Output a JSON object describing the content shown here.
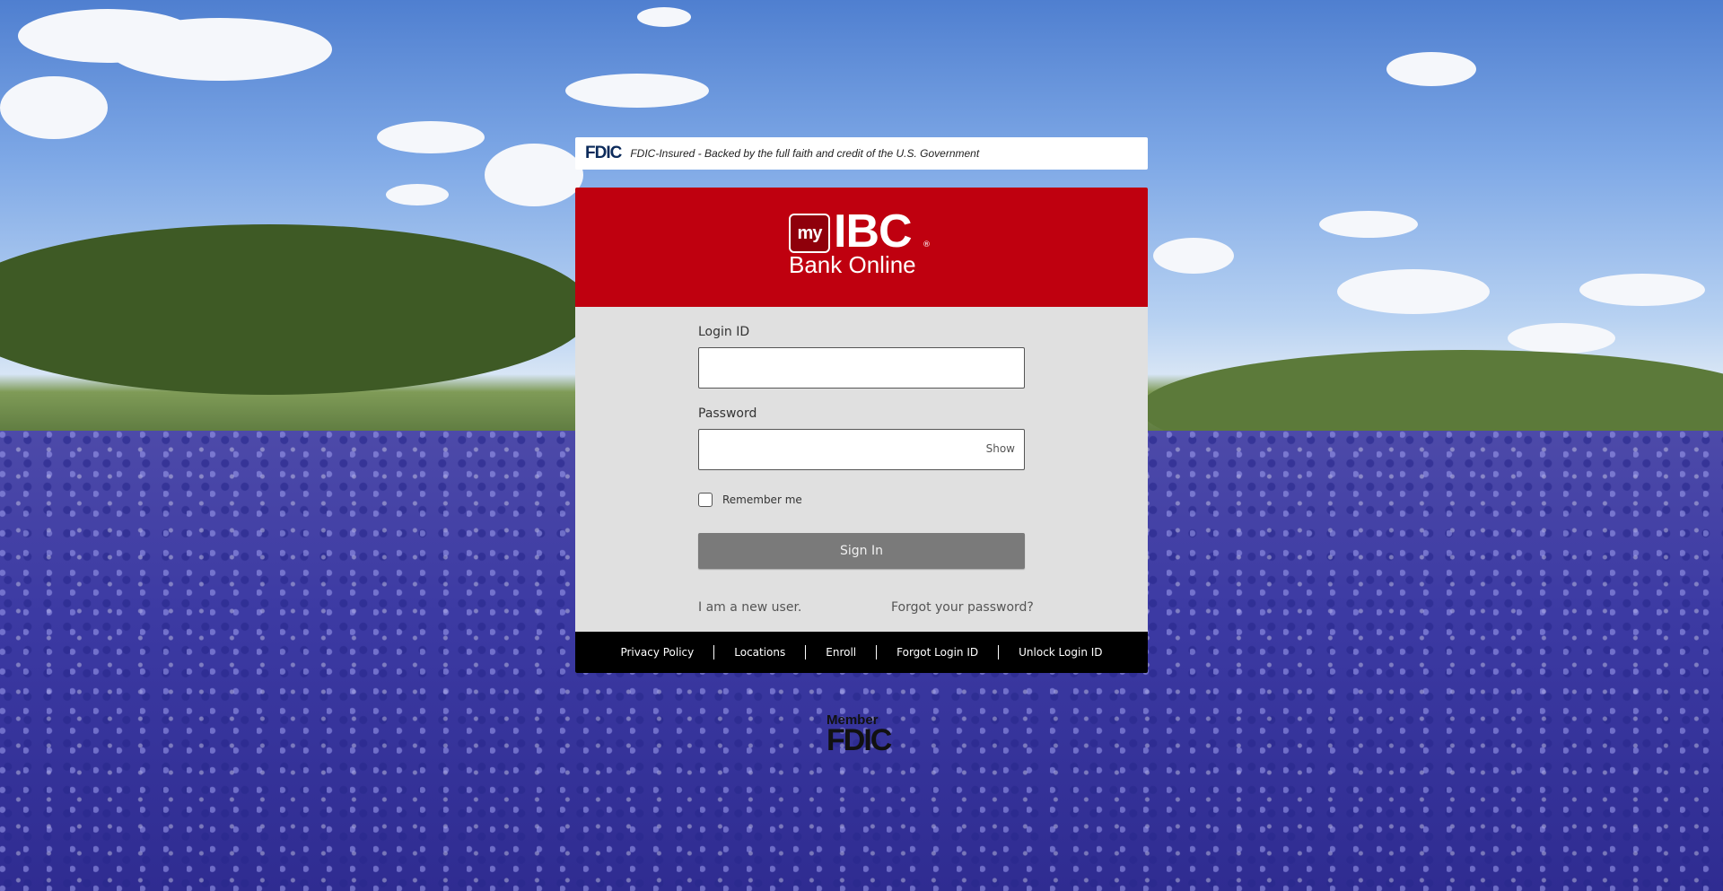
{
  "banner": {
    "fdic_logo": "FDIC",
    "text": "FDIC-Insured - Backed by the full faith and credit of the U.S. Government"
  },
  "brand": {
    "my": "my",
    "name": "IBC",
    "registered": "®",
    "subtitle": "Bank Online",
    "header_color": "#bf000f"
  },
  "form": {
    "login_id_label": "Login ID",
    "login_id_value": "",
    "password_label": "Password",
    "password_value": "",
    "show_label": "Show",
    "remember_label": "Remember me",
    "remember_checked": false,
    "sign_in_label": "Sign In",
    "new_user_label": "I am a new user.",
    "forgot_password_label": "Forgot your password?"
  },
  "footer": {
    "links": [
      "Privacy Policy",
      "Locations",
      "Enroll",
      "Forgot Login ID",
      "Unlock Login ID"
    ]
  },
  "member_fdic": {
    "line1": "Member",
    "line2": "FDIC"
  }
}
